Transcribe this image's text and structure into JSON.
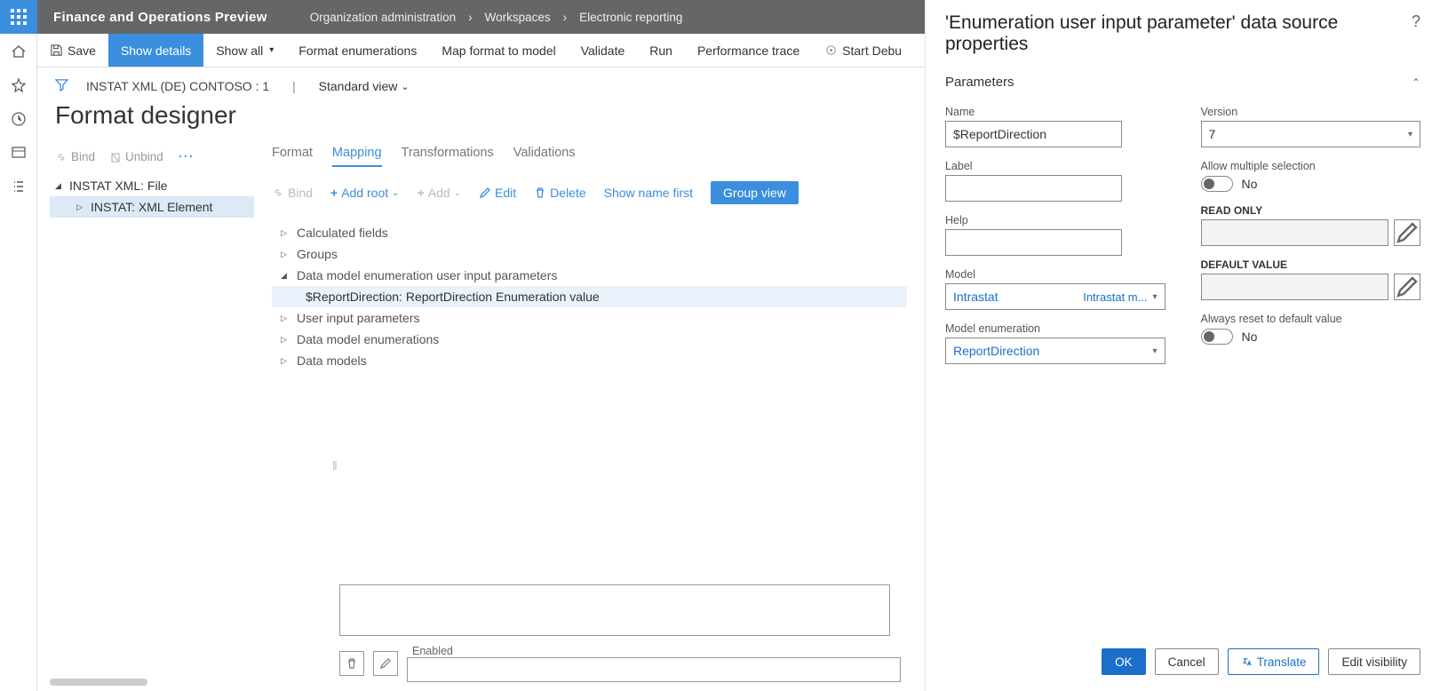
{
  "header": {
    "app_title": "Finance and Operations Preview",
    "breadcrumb": [
      "Organization administration",
      "Workspaces",
      "Electronic reporting"
    ]
  },
  "action_bar": {
    "save": "Save",
    "show_details": "Show details",
    "show_all": "Show all",
    "format_enums": "Format enumerations",
    "map_format": "Map format to model",
    "validate": "Validate",
    "run": "Run",
    "perf_trace": "Performance trace",
    "start_debug": "Start Debu"
  },
  "doc": {
    "id": "INSTAT XML (DE) CONTOSO : 1",
    "view": "Standard view",
    "page_title": "Format designer"
  },
  "left_toolbar": {
    "bind": "Bind",
    "unbind": "Unbind"
  },
  "format_tree": {
    "root": "INSTAT XML: File",
    "child": "INSTAT: XML Element"
  },
  "tabs": {
    "format": "Format",
    "mapping": "Mapping",
    "transformations": "Transformations",
    "validations": "Validations"
  },
  "mapping_toolbar": {
    "bind": "Bind",
    "add_root": "Add root",
    "add": "Add",
    "edit": "Edit",
    "delete": "Delete",
    "show_name_first": "Show name first",
    "group_view": "Group view"
  },
  "mapping_tree": {
    "items": [
      "Calculated fields",
      "Groups",
      "Data model enumeration user input parameters",
      "$ReportDirection: ReportDirection Enumeration value",
      "User input parameters",
      "Data model enumerations",
      "Data models"
    ]
  },
  "bottom": {
    "enabled_label": "Enabled"
  },
  "props": {
    "title": "'Enumeration user input parameter' data source properties",
    "section": "Parameters",
    "name_lbl": "Name",
    "name_val": "$ReportDirection",
    "label_lbl": "Label",
    "help_lbl": "Help",
    "model_lbl": "Model",
    "model_val": "Intrastat",
    "model_sec": "Intrastat m...",
    "model_enum_lbl": "Model enumeration",
    "model_enum_val": "ReportDirection",
    "version_lbl": "Version",
    "version_val": "7",
    "allow_multi_lbl": "Allow multiple selection",
    "allow_multi_val": "No",
    "readonly_lbl": "READ ONLY",
    "default_lbl": "DEFAULT VALUE",
    "reset_lbl": "Always reset to default value",
    "reset_val": "No"
  },
  "footer": {
    "ok": "OK",
    "cancel": "Cancel",
    "translate": "Translate",
    "edit_vis": "Edit visibility"
  }
}
